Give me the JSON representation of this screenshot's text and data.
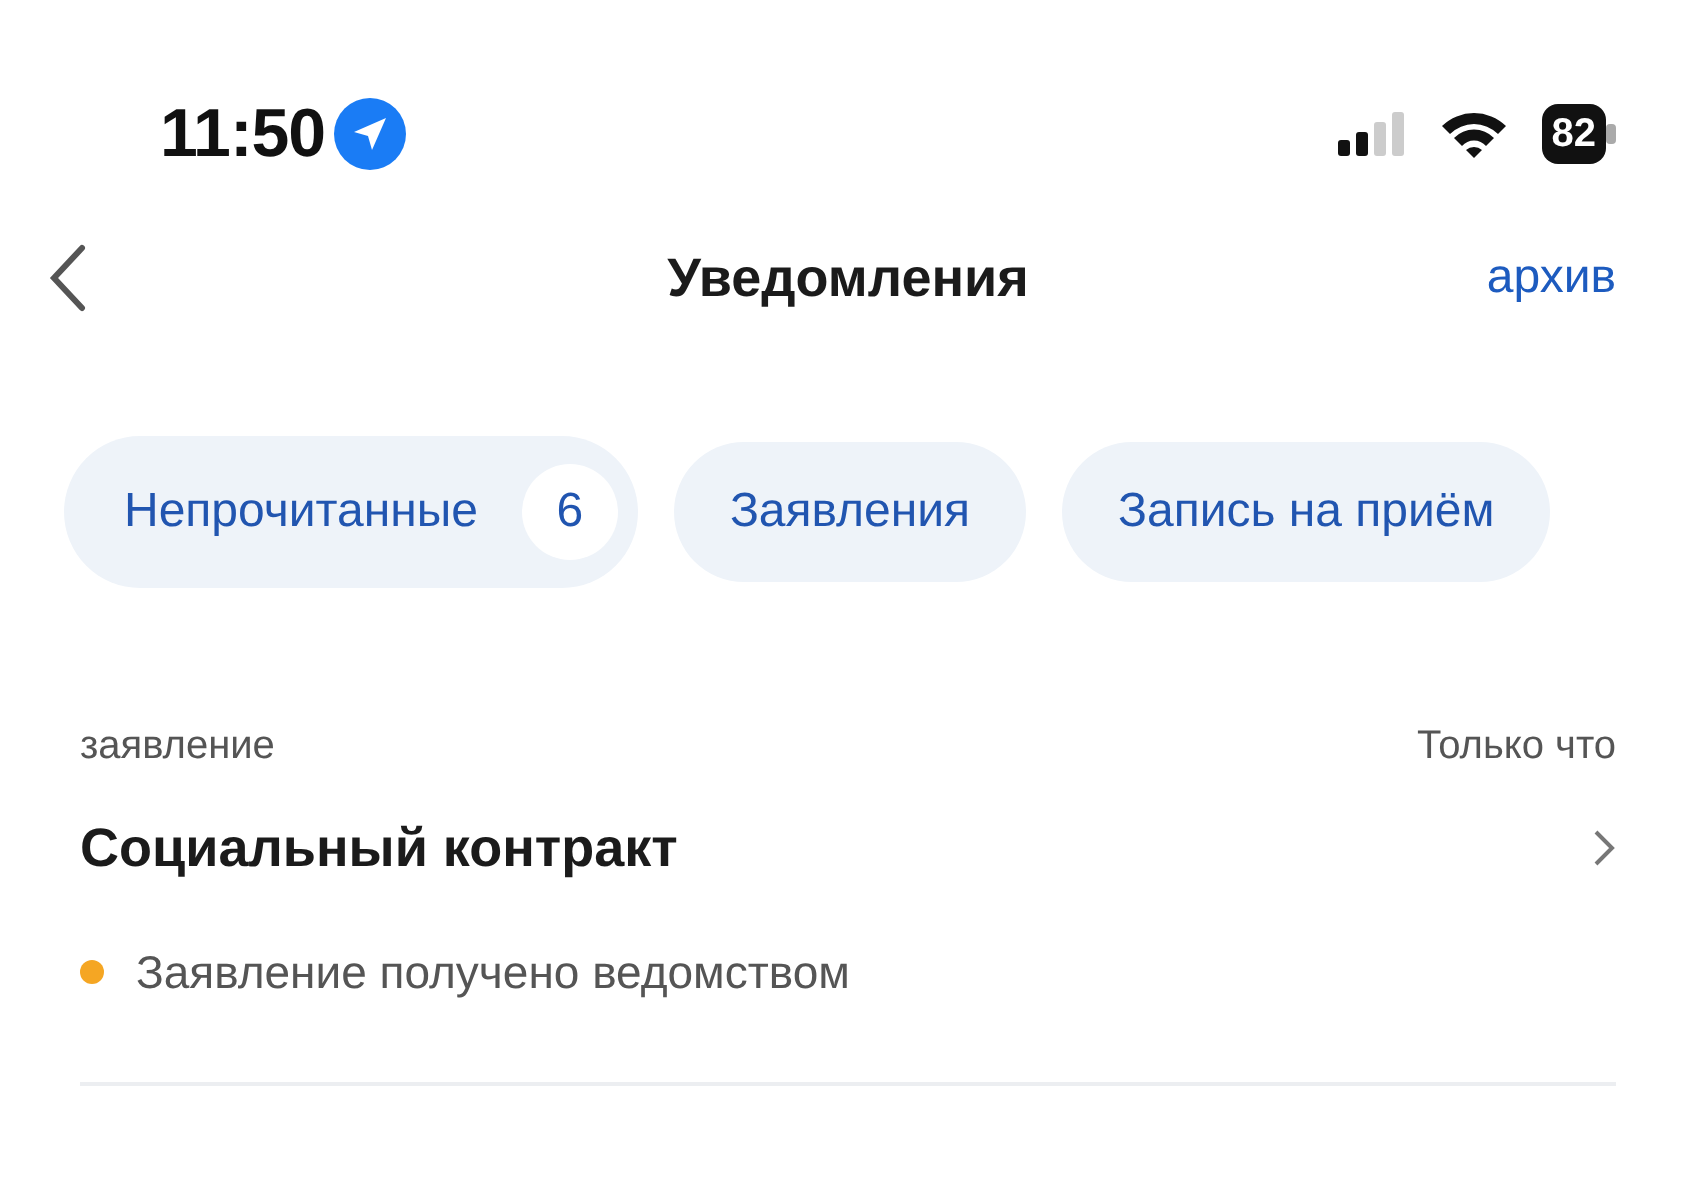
{
  "status_bar": {
    "time": "11:50",
    "battery": "82"
  },
  "header": {
    "title": "Уведомления",
    "action": "архив"
  },
  "filters": [
    {
      "label": "Непрочитанные",
      "count": "6",
      "selected": true
    },
    {
      "label": "Заявления",
      "selected": false
    },
    {
      "label": "Запись на приём",
      "selected": false
    }
  ],
  "notifications": [
    {
      "category": "заявление",
      "time": "Только что",
      "title": "Социальный контракт",
      "status": "Заявление получено ведомством",
      "color": "#f5a623"
    }
  ]
}
